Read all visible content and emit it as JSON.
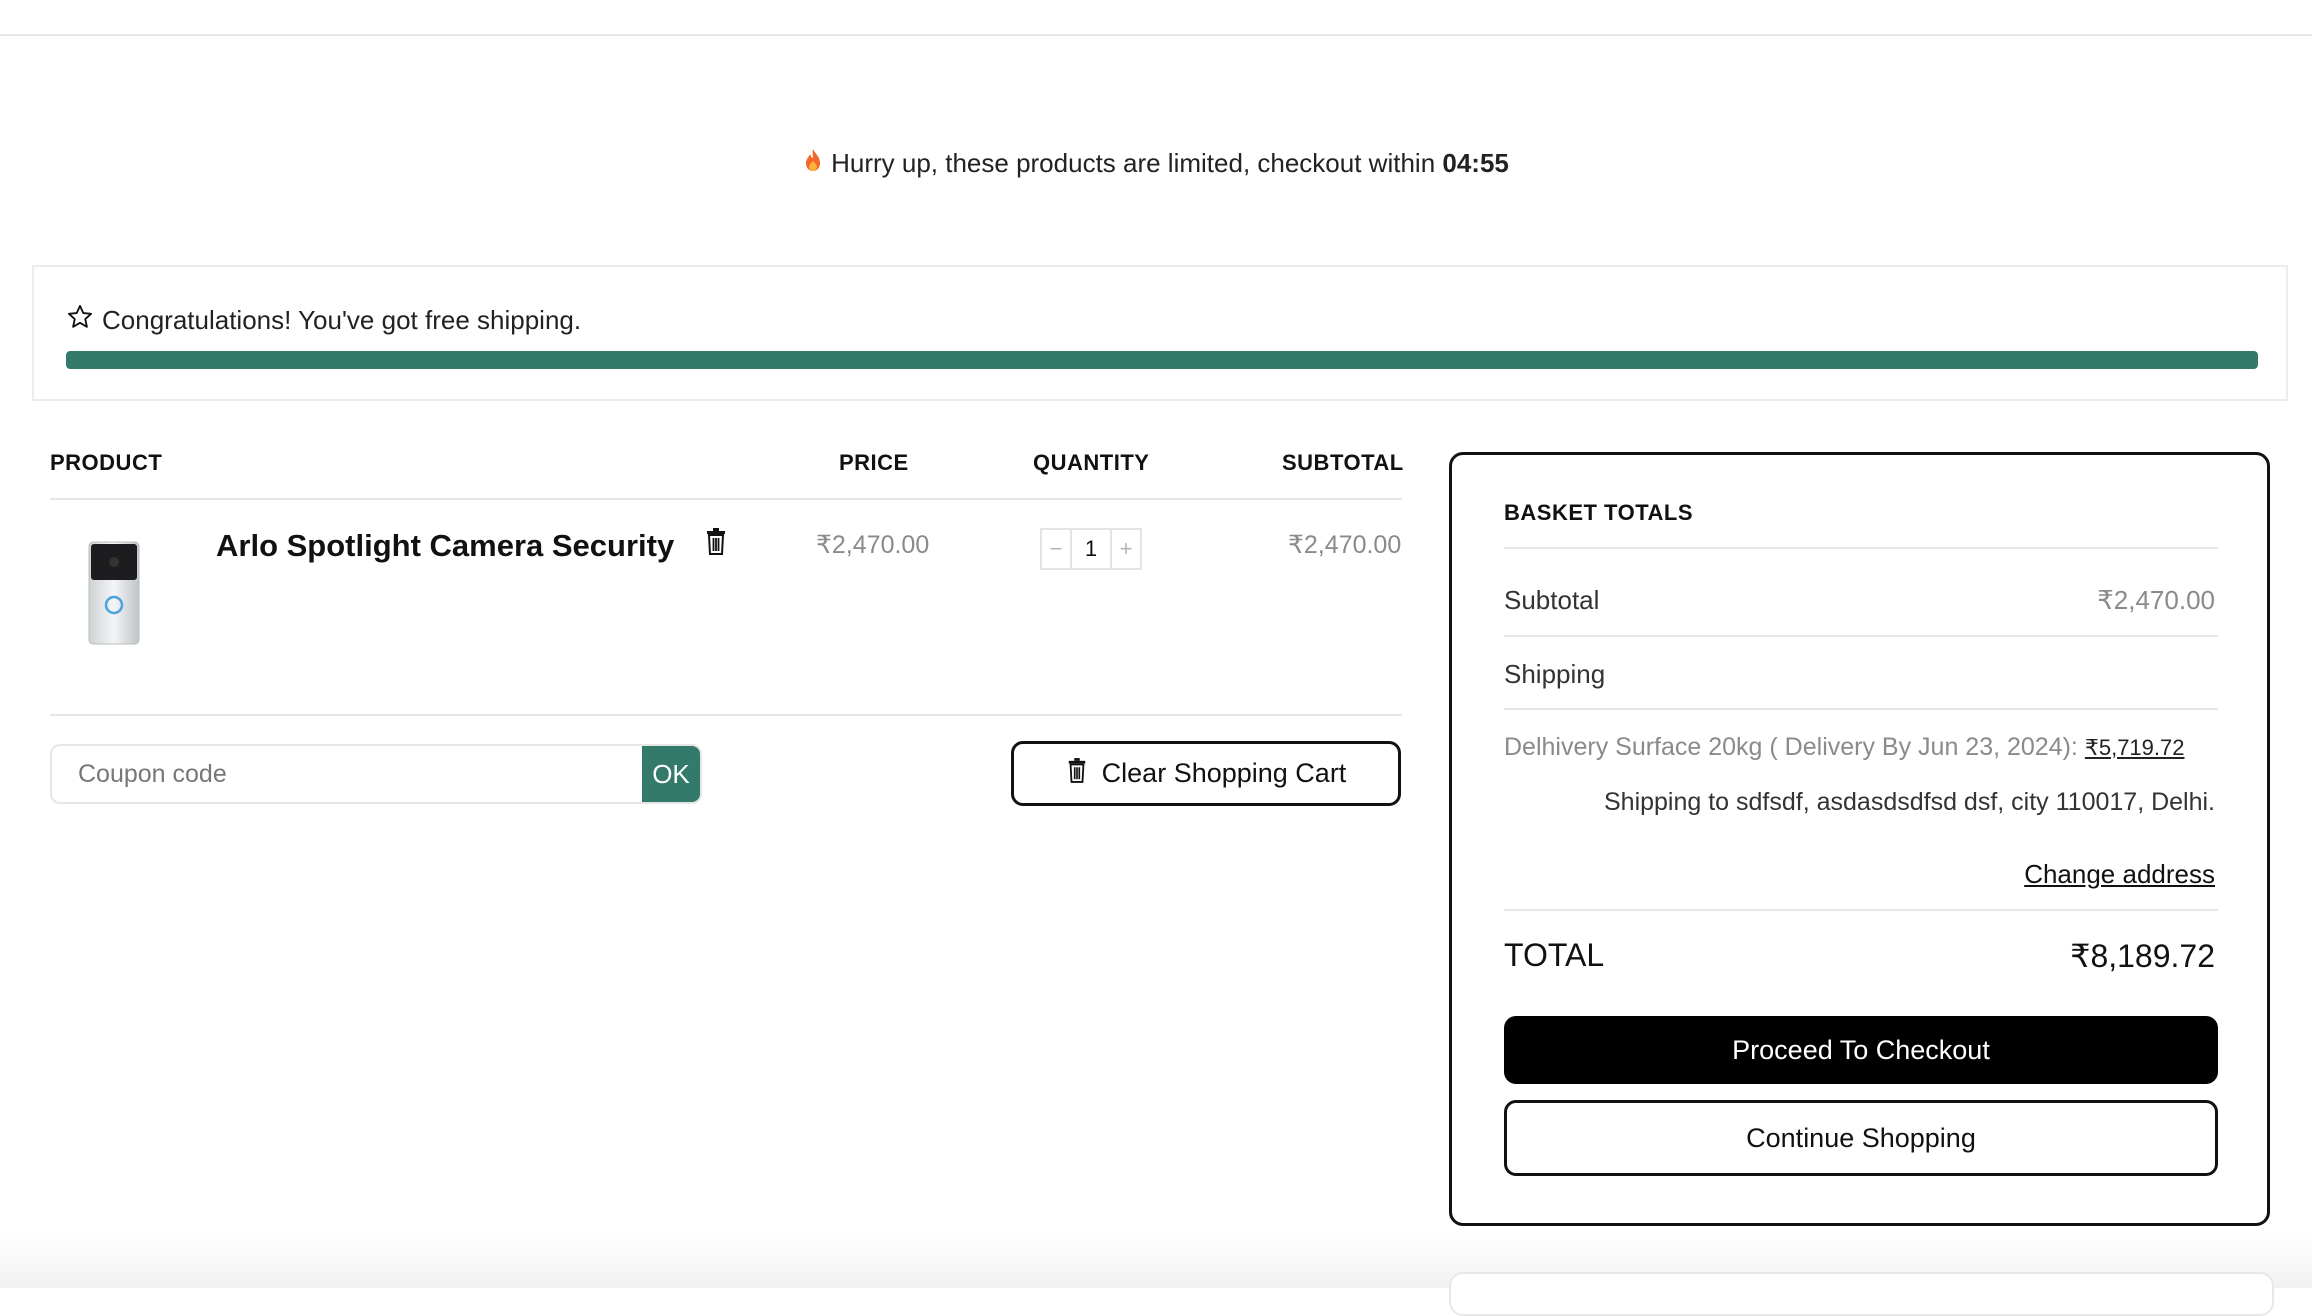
{
  "urgency": {
    "icon": "fire-icon",
    "message": "Hurry up, these products are limited, checkout within",
    "timer": "04:55"
  },
  "shipping_notice": {
    "icon": "star-outline-icon",
    "message": "Congratulations! You've got free shipping.",
    "progress": 1.0,
    "bar_color": "#347a6a"
  },
  "cart": {
    "headers": {
      "product": "PRODUCT",
      "price": "PRICE",
      "quantity": "QUANTITY",
      "subtotal": "SUBTOTAL"
    },
    "items": [
      {
        "name": "Arlo Spotlight Camera Security",
        "image": "doorbell-camera-image",
        "price": "₹2,470.00",
        "quantity": "1",
        "subtotal": "₹2,470.00",
        "decrement": "−",
        "increment": "+"
      }
    ],
    "coupon": {
      "placeholder": "Coupon code",
      "value": "",
      "apply_label": "OK",
      "apply_color": "#347a6a"
    },
    "clear_label": "Clear Shopping Cart"
  },
  "basket": {
    "title": "BASKET TOTALS",
    "subtotal_label": "Subtotal",
    "subtotal_value": "₹2,470.00",
    "shipping_label": "Shipping",
    "shipping_method": "Delhivery Surface 20kg ( Delivery By Jun 23, 2024):",
    "shipping_amount": "₹5,719.72",
    "ship_to": "Shipping to sdfsdf, asdasdsdfsd dsf, city 110017, Delhi.",
    "change_address": "Change address",
    "total_label": "TOTAL",
    "total_value": "₹8,189.72",
    "checkout_label": "Proceed To Checkout",
    "continue_label": "Continue Shopping"
  }
}
